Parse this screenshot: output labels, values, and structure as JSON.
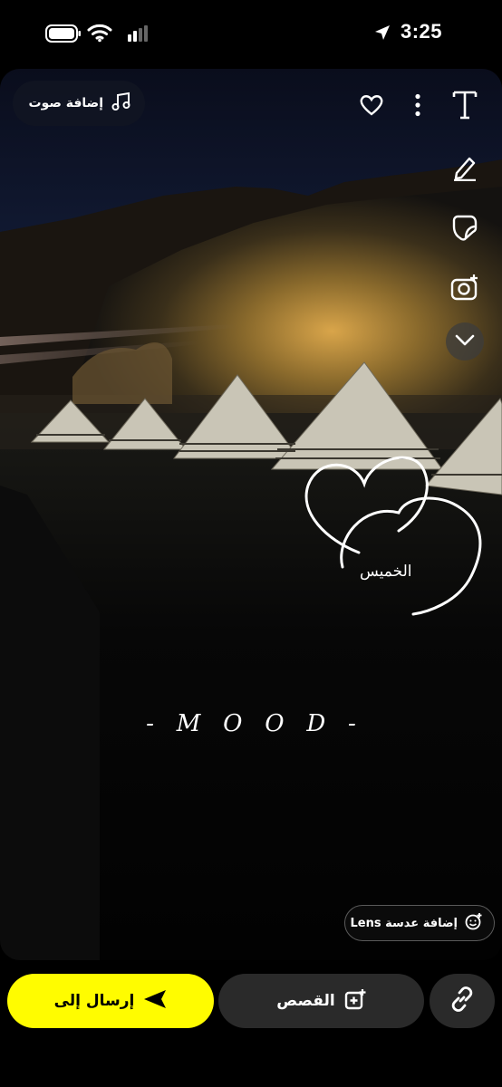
{
  "status_bar": {
    "time": "3:25",
    "icons": [
      "battery-icon",
      "wifi-icon",
      "cellular-signal-icon",
      "location-arrow-icon"
    ]
  },
  "editor": {
    "add_sound_label": "إضافة صوت",
    "add_lens_label": "إضافة عدسة Lens",
    "toolbar_icons": [
      "favorite-heart-icon",
      "more-options-icon",
      "text-tool-icon",
      "draw-pencil-icon",
      "sticker-icon",
      "camera-lens-icon",
      "chevron-down-icon"
    ]
  },
  "overlay": {
    "day_text": "الخميس",
    "mood_text": "-   M   O   O   D   -"
  },
  "bottom_bar": {
    "stories_label": "القصص",
    "send_label": "إرسال إلى",
    "link_icon": "link-icon"
  },
  "colors": {
    "send_button": "#FFFC00",
    "dark_button": "#2A2A2A",
    "background": "#000000"
  }
}
